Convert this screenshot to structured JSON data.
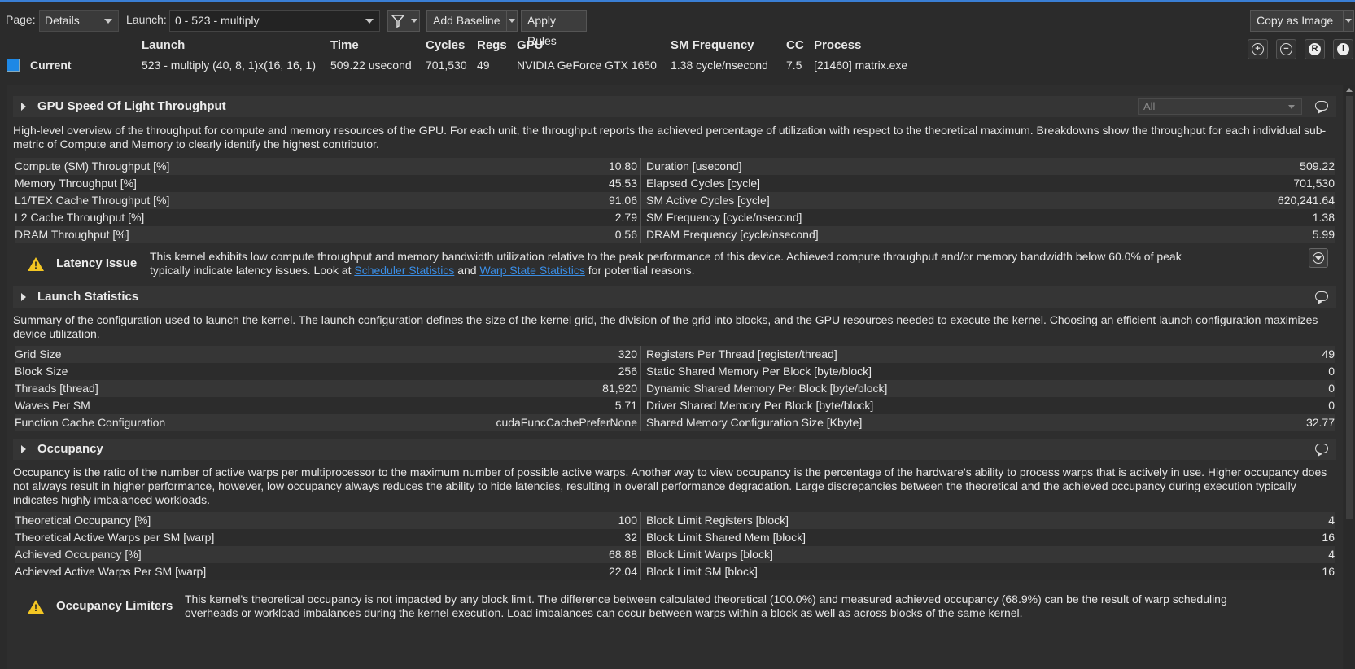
{
  "toolbar": {
    "page_label": "Page:",
    "page_value": "Details",
    "launch_label": "Launch:",
    "launch_value": "0 -   523 - multiply",
    "add_baseline": "Add Baseline",
    "apply_rules": "Apply Rules",
    "copy_as_image": "Copy as Image"
  },
  "header": {
    "columns": [
      "Launch",
      "Time",
      "Cycles",
      "Regs",
      "GPU",
      "SM Frequency",
      "CC",
      "Process"
    ],
    "row_label": "Current",
    "values": [
      "523 - multiply (40, 8, 1)x(16, 16, 1)",
      "509.22 usecond",
      "701,530",
      "49",
      "NVIDIA GeForce GTX 1650",
      "1.38 cycle/nsecond",
      "7.5",
      "[21460] matrix.exe"
    ],
    "icons": [
      "zoom-in-icon",
      "zoom-out-icon",
      "rules-icon",
      "info-icon"
    ],
    "swatch_color": "#1e88e5"
  },
  "sections": {
    "sol": {
      "title": "GPU Speed Of Light Throughput",
      "filter": "All",
      "description": "High-level overview of the throughput for compute and memory resources of the GPU. For each unit, the throughput reports the achieved percentage of utilization with respect to the theoretical maximum. Breakdowns show the throughput for each individual sub-metric of Compute and Memory to clearly identify the highest contributor.",
      "rows": [
        {
          "k1": "Compute (SM) Throughput [%]",
          "v1": "10.80",
          "k2": "Duration [usecond]",
          "v2": "509.22"
        },
        {
          "k1": "Memory Throughput [%]",
          "v1": "45.53",
          "k2": "Elapsed Cycles [cycle]",
          "v2": "701,530"
        },
        {
          "k1": "L1/TEX Cache Throughput [%]",
          "v1": "91.06",
          "k2": "SM Active Cycles [cycle]",
          "v2": "620,241.64"
        },
        {
          "k1": "L2 Cache Throughput [%]",
          "v1": "2.79",
          "k2": "SM Frequency [cycle/nsecond]",
          "v2": "1.38"
        },
        {
          "k1": "DRAM Throughput [%]",
          "v1": "0.56",
          "k2": "DRAM Frequency [cycle/nsecond]",
          "v2": "5.99"
        }
      ],
      "issue_title": "Latency Issue",
      "issue_text_1": "This kernel exhibits low compute throughput and memory bandwidth utilization relative to the peak performance of this device. Achieved compute throughput and/or memory bandwidth below 60.0% of peak",
      "issue_text_2a": "typically indicate latency issues. Look at ",
      "issue_link_1": "Scheduler Statistics",
      "issue_text_2b": " and ",
      "issue_link_2": "Warp State Statistics",
      "issue_text_2c": " for potential reasons."
    },
    "launch": {
      "title": "Launch Statistics",
      "description": "Summary of the configuration used to launch the kernel. The launch configuration defines the size of the kernel grid, the division of the grid into blocks, and the GPU resources needed to execute the kernel. Choosing an efficient launch configuration maximizes device utilization.",
      "rows": [
        {
          "k1": "Grid Size",
          "v1": "320",
          "k2": "Registers Per Thread [register/thread]",
          "v2": "49"
        },
        {
          "k1": "Block Size",
          "v1": "256",
          "k2": "Static Shared Memory Per Block [byte/block]",
          "v2": "0"
        },
        {
          "k1": "Threads [thread]",
          "v1": "81,920",
          "k2": "Dynamic Shared Memory Per Block [byte/block]",
          "v2": "0"
        },
        {
          "k1": "Waves Per SM",
          "v1": "5.71",
          "k2": "Driver Shared Memory Per Block [byte/block]",
          "v2": "0"
        },
        {
          "k1": "Function Cache Configuration",
          "v1": "cudaFuncCachePreferNone",
          "k2": "Shared Memory Configuration Size [Kbyte]",
          "v2": "32.77"
        }
      ]
    },
    "occupancy": {
      "title": "Occupancy",
      "description": "Occupancy is the ratio of the number of active warps per multiprocessor to the maximum number of possible active warps. Another way to view occupancy is the percentage of the hardware's ability to process warps that is actively in use. Higher occupancy does not always result in higher performance, however, low occupancy always reduces the ability to hide latencies, resulting in overall performance degradation. Large discrepancies between the theoretical and the achieved occupancy during execution typically indicates highly imbalanced workloads.",
      "rows": [
        {
          "k1": "Theoretical Occupancy [%]",
          "v1": "100",
          "k2": "Block Limit Registers [block]",
          "v2": "4"
        },
        {
          "k1": "Theoretical Active Warps per SM [warp]",
          "v1": "32",
          "k2": "Block Limit Shared Mem [block]",
          "v2": "16"
        },
        {
          "k1": "Achieved Occupancy [%]",
          "v1": "68.88",
          "k2": "Block Limit Warps [block]",
          "v2": "4"
        },
        {
          "k1": "Achieved Active Warps Per SM [warp]",
          "v1": "22.04",
          "k2": "Block Limit SM [block]",
          "v2": "16"
        }
      ],
      "issue_title": "Occupancy Limiters",
      "issue_text_1": "This kernel's theoretical occupancy is not impacted by any block limit. The difference between calculated theoretical (100.0%) and measured achieved occupancy (68.9%) can be the result of warp scheduling",
      "issue_text_2": "overheads or workload imbalances during the kernel execution. Load imbalances can occur between warps within a block as well as across blocks of the same kernel."
    }
  }
}
